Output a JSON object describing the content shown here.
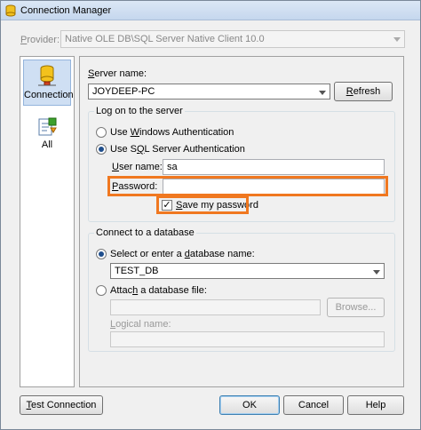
{
  "window": {
    "title": "Connection Manager"
  },
  "provider": {
    "label": "Provider:",
    "value": "Native OLE DB\\SQL Server Native Client 10.0"
  },
  "sidebar": {
    "items": [
      {
        "label": "Connection",
        "selected": true
      },
      {
        "label": "All",
        "selected": false
      }
    ]
  },
  "server": {
    "label": "Server name:",
    "value": "JOYDEEP-PC",
    "refresh_label": "Refresh"
  },
  "logon": {
    "title": "Log on to the server",
    "windows_auth_label": "Use Windows Authentication",
    "sql_auth_label": "Use SQL Server Authentication",
    "selected": "sql",
    "username_label": "User name:",
    "username_value": "sa",
    "password_label": "Password:",
    "password_value": "",
    "save_password_label": "Save my password",
    "save_password_checked": true
  },
  "database": {
    "title": "Connect to a database",
    "select_label": "Select or enter a database name:",
    "select_value": "TEST_DB",
    "attach_label": "Attach a database file:",
    "attach_value": "",
    "browse_label": "Browse...",
    "logical_label": "Logical name:",
    "logical_value": ""
  },
  "footer": {
    "test_label": "Test Connection",
    "ok_label": "OK",
    "cancel_label": "Cancel",
    "help_label": "Help"
  },
  "colors": {
    "highlight": "#f07820",
    "selection": "#cfdff3"
  }
}
